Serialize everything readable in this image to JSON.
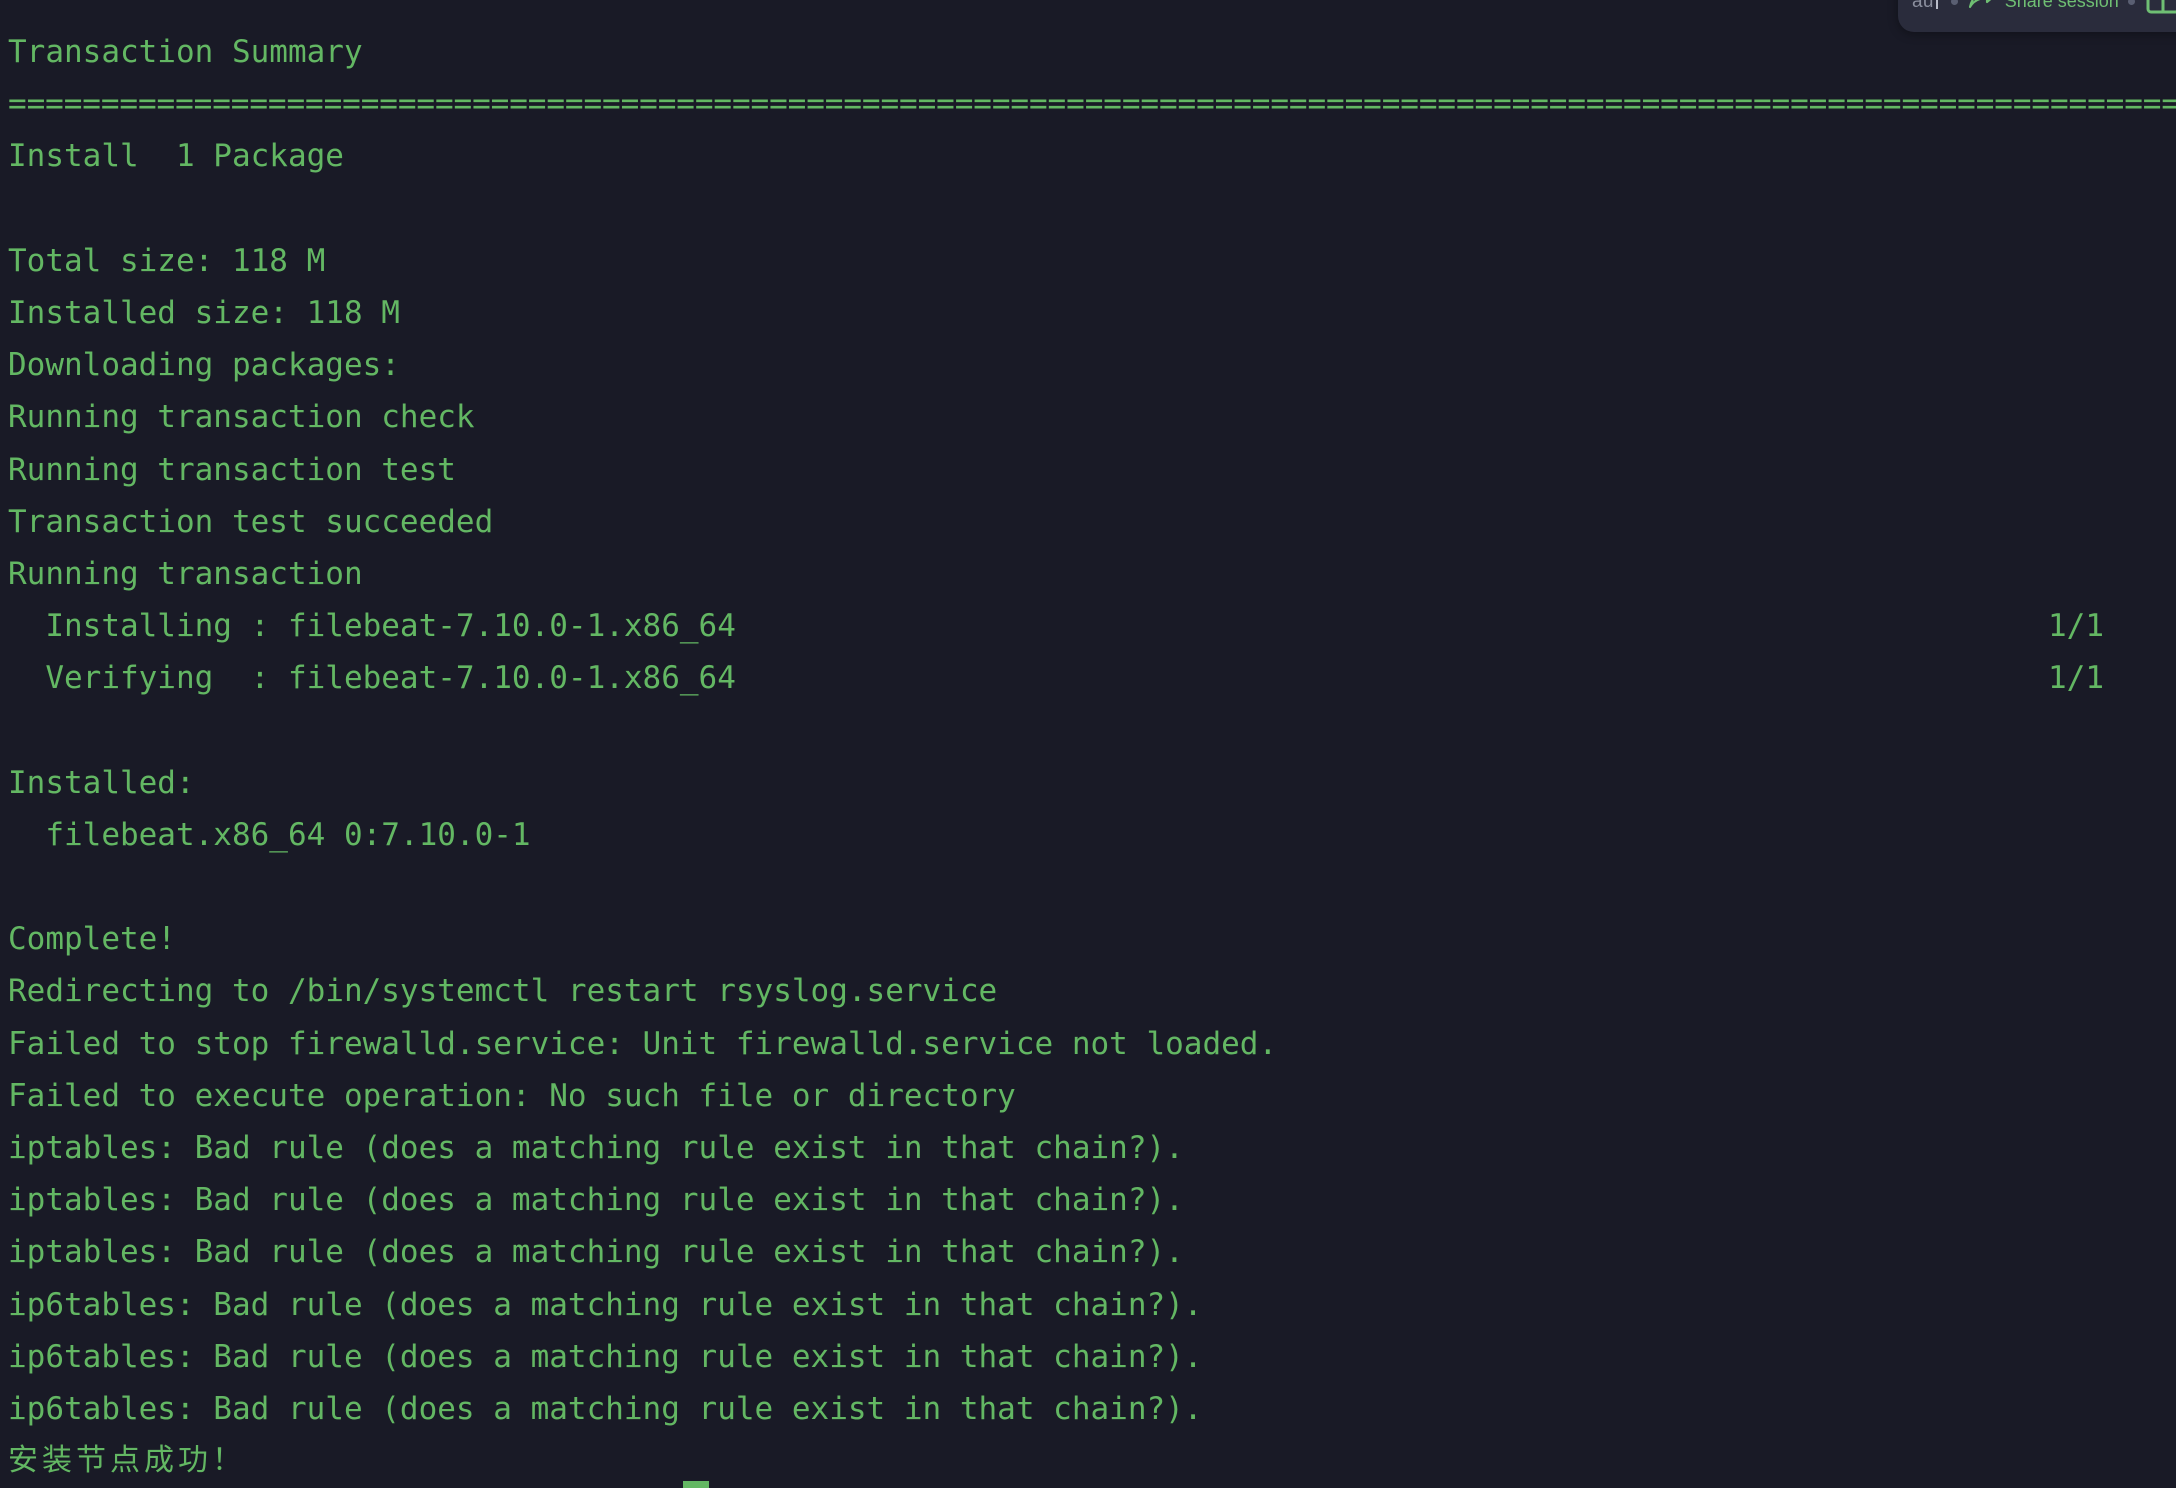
{
  "window": {
    "background_color": "#191a26",
    "text_color": "#63b763"
  },
  "toolbar": {
    "input_value": "au",
    "share_label": "Share session",
    "share_icon": "share-arrow-icon",
    "panel_icon": "split-panel-icon",
    "dot_separator": "dot-separator-icon",
    "accent_color": "#6fbf73",
    "background_color": "#2a2c3c"
  },
  "terminal": {
    "prompt_cursor": "block-cursor",
    "lines": [
      {
        "text": "Transaction Summary",
        "kind": "text"
      },
      {
        "text": "================================================================================================================================",
        "kind": "separator"
      },
      {
        "text": "Install  1 Package",
        "kind": "text"
      },
      {
        "text": "",
        "kind": "blank"
      },
      {
        "text": "Total size: 118 M",
        "kind": "text"
      },
      {
        "text": "Installed size: 118 M",
        "kind": "text"
      },
      {
        "text": "Downloading packages:",
        "kind": "text"
      },
      {
        "text": "Running transaction check",
        "kind": "text"
      },
      {
        "text": "Running transaction test",
        "kind": "text"
      },
      {
        "text": "Transaction test succeeded",
        "kind": "text"
      },
      {
        "text": "Running transaction",
        "kind": "text"
      },
      {
        "text": "  Installing : filebeat-7.10.0-1.x86_64",
        "right": "1/1",
        "kind": "text-right"
      },
      {
        "text": "  Verifying  : filebeat-7.10.0-1.x86_64",
        "right": "1/1",
        "kind": "text-right"
      },
      {
        "text": "",
        "kind": "blank"
      },
      {
        "text": "Installed:",
        "kind": "text"
      },
      {
        "text": "  filebeat.x86_64 0:7.10.0-1",
        "kind": "text"
      },
      {
        "text": "",
        "kind": "blank"
      },
      {
        "text": "Complete!",
        "kind": "text"
      },
      {
        "text": "Redirecting to /bin/systemctl restart rsyslog.service",
        "kind": "text"
      },
      {
        "text": "Failed to stop firewalld.service: Unit firewalld.service not loaded.",
        "kind": "text"
      },
      {
        "text": "Failed to execute operation: No such file or directory",
        "kind": "text"
      },
      {
        "text": "iptables: Bad rule (does a matching rule exist in that chain?).",
        "kind": "text"
      },
      {
        "text": "iptables: Bad rule (does a matching rule exist in that chain?).",
        "kind": "text"
      },
      {
        "text": "iptables: Bad rule (does a matching rule exist in that chain?).",
        "kind": "text"
      },
      {
        "text": "ip6tables: Bad rule (does a matching rule exist in that chain?).",
        "kind": "text"
      },
      {
        "text": "ip6tables: Bad rule (does a matching rule exist in that chain?).",
        "kind": "text"
      },
      {
        "text": "ip6tables: Bad rule (does a matching rule exist in that chain?).",
        "kind": "text"
      },
      {
        "text": "安装节点成功！",
        "kind": "cjk"
      }
    ]
  }
}
